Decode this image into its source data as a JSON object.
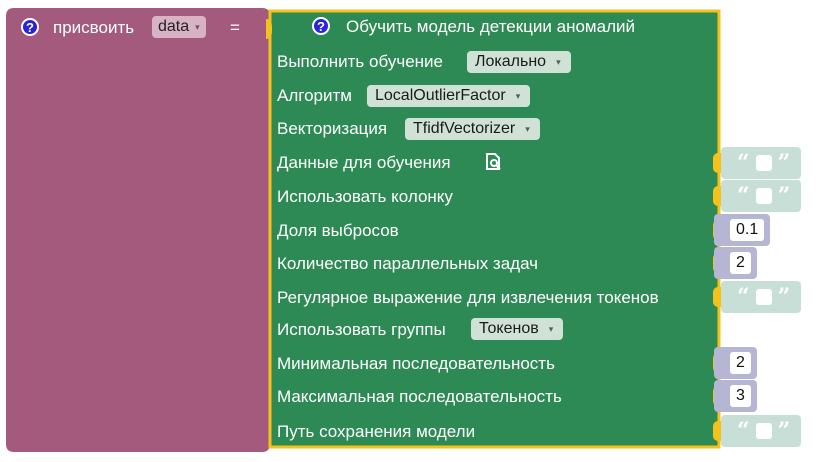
{
  "assign": {
    "label": "присвоить",
    "variable": "data",
    "equals": "=",
    "help": "?"
  },
  "block": {
    "title": "Обучить модель детекции аномалий",
    "help": "?",
    "rows": {
      "run_label": "Выполнить обучение",
      "run_value": "Локально",
      "algo_label": "Алгоритм",
      "algo_value": "LocalOutlierFactor",
      "vec_label": "Векторизация",
      "vec_value": "TfidfVectorizer",
      "data_label": "Данные для обучения",
      "column_label": "Использовать колонку",
      "contamination_label": "Доля выбросов",
      "contamination_value": "0.1",
      "jobs_label": "Количество параллельных задач",
      "jobs_value": "2",
      "regex_label": "Регулярное выражение для извлечения токенов",
      "groups_label": "Использовать группы",
      "groups_value": "Токенов",
      "min_label": "Минимальная последовательность",
      "min_value": "2",
      "max_label": "Максимальная последовательность",
      "max_value": "3",
      "path_label": "Путь сохранения модели"
    }
  },
  "text_socket": {
    "open_quote": "“",
    "close_quote": "”"
  },
  "colors": {
    "assign_block": "#a45a7c",
    "ml_block": "#2e8a55",
    "selection_outline": "#f5c21b",
    "text_socket": "#c7dfd7",
    "number_socket": "#b4b6d3",
    "help_icon": "#2b24d6"
  },
  "icons": {
    "caret": "▾",
    "data_search": "search-document-icon"
  }
}
